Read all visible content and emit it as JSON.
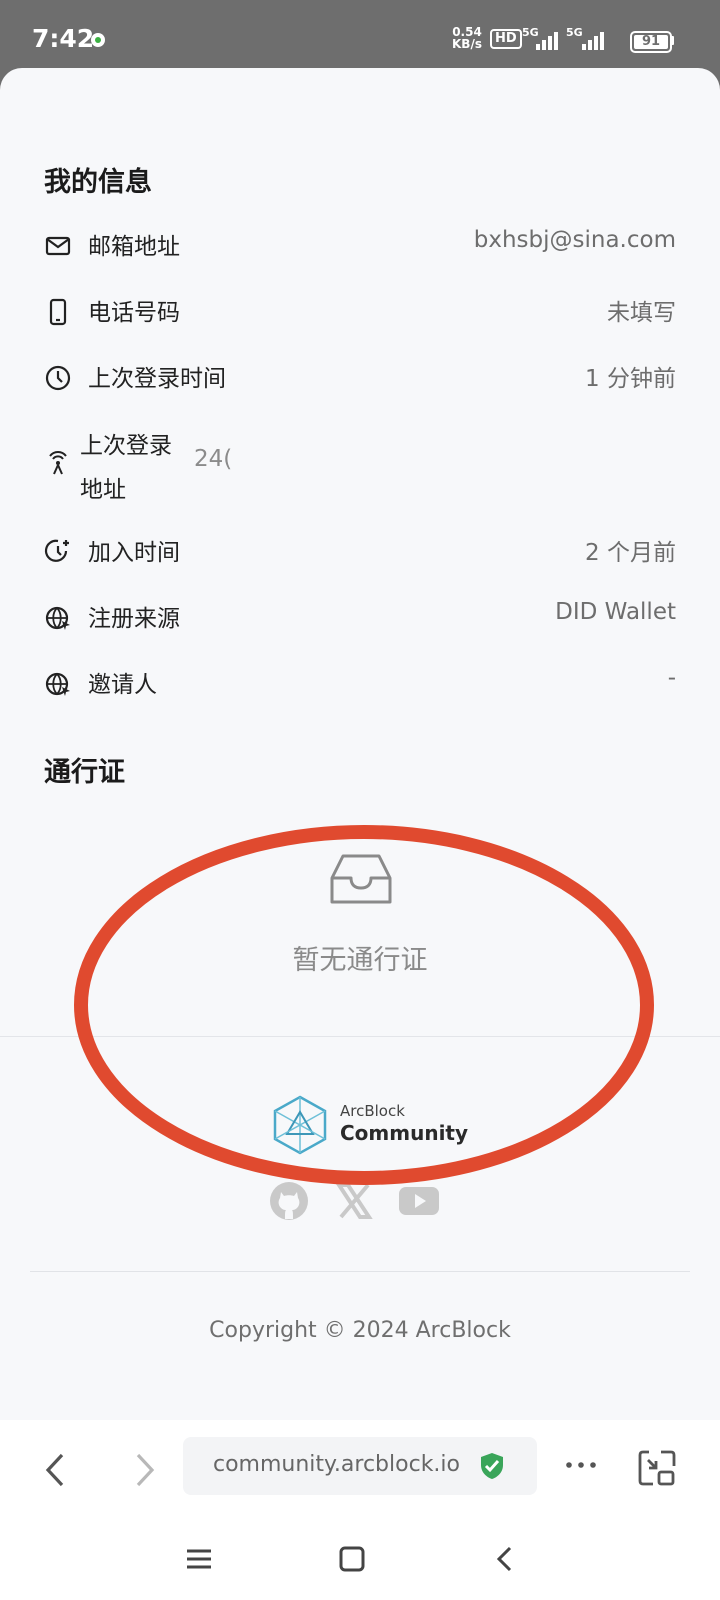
{
  "status_bar": {
    "time": "7:42",
    "speed_top": "0.54",
    "speed_bottom": "KB/s",
    "hd": "HD",
    "network1": "5G",
    "network2": "5G",
    "battery": "91"
  },
  "my_info": {
    "title": "我的信息",
    "rows": [
      {
        "icon": "mail-icon",
        "label": "邮箱地址",
        "value": "bxhsbj@sina.com"
      },
      {
        "icon": "phone-icon",
        "label": "电话号码",
        "value": "未填写"
      },
      {
        "icon": "clock-icon",
        "label": "上次登录时间",
        "value": "1 分钟前"
      },
      {
        "icon": "antenna-icon",
        "label": "上次登录地址",
        "value": "24("
      },
      {
        "icon": "clock-plus-icon",
        "label": "加入时间",
        "value": "2 个月前"
      },
      {
        "icon": "globe-icon",
        "label": "注册来源",
        "value": "DID Wallet"
      },
      {
        "icon": "globe-icon",
        "label": "邀请人",
        "value": "-"
      }
    ]
  },
  "passport": {
    "title": "通行证",
    "empty_text": "暂无通行证"
  },
  "footer": {
    "brand_small": "ArcBlock",
    "brand_big": "Community",
    "social": [
      "github-icon",
      "x-icon",
      "youtube-icon"
    ],
    "copyright": "Copyright © 2024 ArcBlock"
  },
  "browser": {
    "url": "community.arcblock.io"
  },
  "colors": {
    "annotation": "#e04a2f",
    "shield": "#3aa55a",
    "logo": "#4aa9c9"
  }
}
